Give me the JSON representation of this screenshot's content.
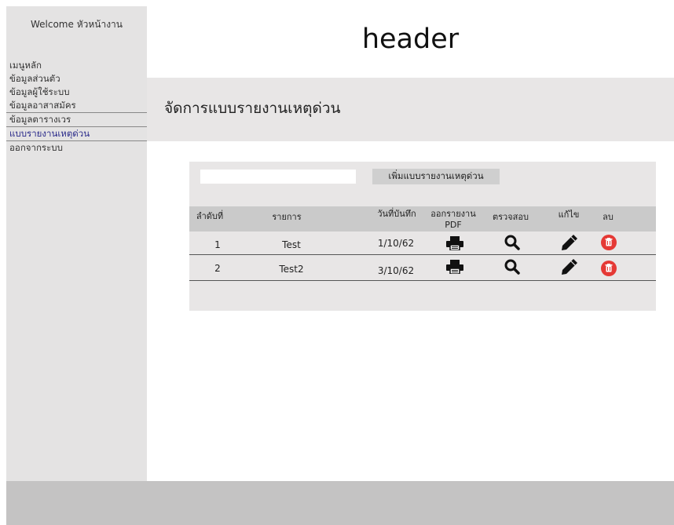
{
  "sidebar": {
    "welcome": "Welcome หัวหน้างาน",
    "items": [
      {
        "label": "เมนูหลัก"
      },
      {
        "label": "ข้อมูลส่วนตัว"
      },
      {
        "label": "ข้อมูลผู้ใช้ระบบ"
      },
      {
        "label": "ข้อมูลอาสาสมัคร"
      },
      {
        "label": "ข้อมูลตารางเวร"
      },
      {
        "label": "แบบรายงานเหตุด่วน"
      },
      {
        "label": "ออกจากระบบ"
      }
    ]
  },
  "header": {
    "title": "header"
  },
  "page": {
    "title": "จัดการแบบรายงานเหตุด่วน"
  },
  "toolbar": {
    "search_value": "",
    "add_label": "เพิ่มแบบรายงานเหตุด่วน"
  },
  "table": {
    "headers": {
      "no": "ลำดับที่",
      "item": "รายการ",
      "date": "วันที่บันทึก",
      "pdf_line1": "ออกรายงาน",
      "pdf_line2": "PDF",
      "check": "ตรวจสอบ",
      "edit": "แก้ไข",
      "delete": "ลบ"
    },
    "rows": [
      {
        "no": "1",
        "item": "Test",
        "date": "1/10/62"
      },
      {
        "no": "2",
        "item": "Test2",
        "date": "3/10/62"
      }
    ]
  },
  "icons": {
    "print": "printer-icon",
    "check": "search-icon",
    "edit": "pencil-icon",
    "delete": "trash-icon"
  },
  "colors": {
    "delete_icon": "#e53935",
    "active_menu": "#2a2a8a"
  }
}
